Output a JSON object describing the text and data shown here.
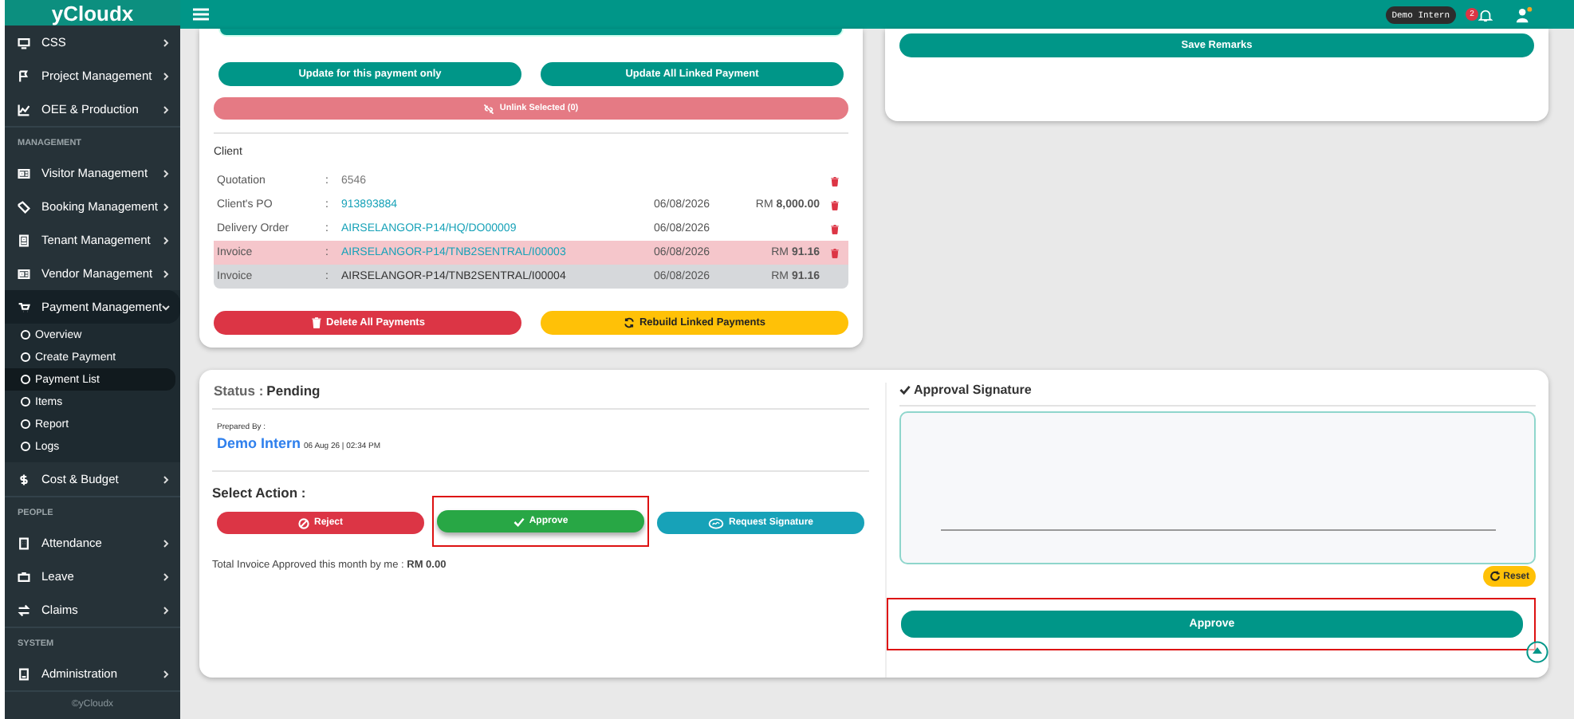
{
  "app": {
    "logo": "yCloudx",
    "footer": "©yCloudx"
  },
  "topbar": {
    "user": "Demo Intern",
    "notifications": "2"
  },
  "sidebar": [
    {
      "kind": "item",
      "label": "CSS",
      "expanded": false
    },
    {
      "kind": "item",
      "label": "Project Management",
      "expanded": false
    },
    {
      "kind": "item",
      "label": "OEE & Production",
      "expanded": false
    },
    {
      "kind": "section",
      "label": "MANAGEMENT"
    },
    {
      "kind": "item",
      "label": "Visitor Management",
      "expanded": false
    },
    {
      "kind": "item",
      "label": "Booking Management",
      "expanded": false
    },
    {
      "kind": "item",
      "label": "Tenant Management",
      "expanded": false
    },
    {
      "kind": "item",
      "label": "Vendor Management",
      "expanded": false
    },
    {
      "kind": "item",
      "label": "Payment Management",
      "expanded": true,
      "children": [
        {
          "label": "Overview",
          "selected": false
        },
        {
          "label": "Create Payment",
          "selected": false
        },
        {
          "label": "Payment List",
          "selected": true
        },
        {
          "label": "Items",
          "selected": false
        },
        {
          "label": "Report",
          "selected": false
        },
        {
          "label": "Logs",
          "selected": false
        }
      ]
    },
    {
      "kind": "item",
      "label": "Cost & Budget",
      "expanded": false
    },
    {
      "kind": "section",
      "label": "PEOPLE"
    },
    {
      "kind": "item",
      "label": "Attendance",
      "expanded": false
    },
    {
      "kind": "item",
      "label": "Leave",
      "expanded": false
    },
    {
      "kind": "item",
      "label": "Claims",
      "expanded": false
    },
    {
      "kind": "section",
      "label": "SYSTEM"
    },
    {
      "kind": "item",
      "label": "Administration",
      "expanded": false
    }
  ],
  "linked_payments": {
    "buttons": [
      "Update for this payment only",
      "Update All Linked Payment"
    ],
    "unlink": "Unlink Selected (0)",
    "heading": "Client",
    "rows": [
      {
        "type": "Quotation",
        "sep": ":",
        "reference": "6546",
        "link": false,
        "date": "",
        "amount": "",
        "deletable": true,
        "selected": false,
        "current": false
      },
      {
        "type": "Client's PO",
        "sep": ":",
        "reference": "913893884",
        "link": true,
        "date": "06/08/2026",
        "amount": "RM **8,000.00**",
        "deletable": true,
        "selected": false,
        "current": false
      },
      {
        "type": "Delivery Order",
        "sep": ":",
        "reference": "AIRSELANGOR-P14/HQ/DO00009",
        "link": true,
        "date": "06/08/2026",
        "amount": "",
        "deletable": true,
        "selected": false,
        "current": false
      },
      {
        "type": "Invoice",
        "sep": ":",
        "reference": "AIRSELANGOR-P14/TNB2SENTRAL/I00003",
        "link": true,
        "date": "06/08/2026",
        "amount": "RM **91.16**",
        "deletable": true,
        "selected": true,
        "current": false
      },
      {
        "type": "Invoice",
        "sep": ":",
        "reference": "AIRSELANGOR-P14/TNB2SENTRAL/I00004",
        "link": false,
        "date": "06/08/2026",
        "amount": "RM **91.16**",
        "deletable": false,
        "selected": false,
        "current": true
      }
    ],
    "delete_all": "Delete All Payments",
    "rebuild": "Rebuild Linked Payments"
  },
  "remarks": {
    "save": "Save Remarks"
  },
  "approval": {
    "status_label": "Status :",
    "status": "Pending",
    "prepared_label": "Prepared By :",
    "prepared_by": "Demo Intern",
    "prepared_at": "06 Aug 26 | 02:34 PM",
    "select_action": "Select Action :",
    "actions": [
      {
        "kind": "reject",
        "label": "Reject",
        "highlighted": false
      },
      {
        "kind": "approve",
        "label": "Approve",
        "highlighted": true
      },
      {
        "kind": "request",
        "label": "Request Signature",
        "highlighted": false
      }
    ],
    "total_text": "Total Invoice Approved this month by me : **RM 0.00**",
    "signature_title": "Approval Signature",
    "reset": "Reset",
    "submit": {
      "label": "Approve",
      "highlighted": true
    }
  }
}
